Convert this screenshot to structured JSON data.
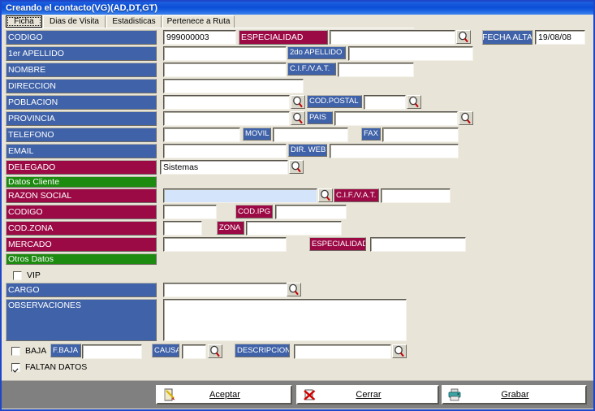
{
  "window": {
    "title": "Creando el contacto(VG)(AD,DT,GT)"
  },
  "tabs": [
    {
      "label": "Ficha",
      "selected": true
    },
    {
      "label": "Dias de Visita",
      "selected": false
    },
    {
      "label": "Estadisticas",
      "selected": false
    },
    {
      "label": "Pertenece a Ruta",
      "selected": false
    }
  ],
  "form": {
    "codigo_label": "CODIGO",
    "codigo_value": "999000003",
    "especialidad_label": "ESPECIALIDAD",
    "especialidad_value": "",
    "fecha_alta_label": "FECHA ALTA",
    "fecha_alta_value": "19/08/08",
    "apellido1_label": "1er APELLIDO",
    "apellido1_value": "",
    "apellido2_label": "2do APELLIDO",
    "apellido2_value": "",
    "nombre_label": "NOMBRE",
    "nombre_value": "",
    "cif_label": "C.I.F./V.A.T.",
    "cif_value": "",
    "direccion_label": "DIRECCION",
    "direccion_value": "",
    "poblacion_label": "POBLACION",
    "poblacion_value": "",
    "codpostal_label": "COD.POSTAL",
    "codpostal_value": "",
    "provincia_label": "PROVINCIA",
    "provincia_value": "",
    "pais_label": "PAIS",
    "pais_value": "",
    "telefono_label": "TELEFONO",
    "telefono_value": "",
    "movil_label": "MOVIL",
    "movil_value": "",
    "fax_label": "FAX",
    "fax_value": "",
    "email_label": "EMAIL",
    "email_value": "",
    "dirweb_label": "DIR. WEB",
    "dirweb_value": "",
    "delegado_label": "DELEGADO",
    "delegado_value": "Sistemas",
    "datos_cliente_header": "Datos Cliente",
    "razon_social_label": "RAZON SOCIAL",
    "razon_social_value": "",
    "cliente_cif_label": "C.I.F./V.A.T.",
    "cliente_cif_value": "",
    "cliente_codigo_label": "CODIGO",
    "cliente_codigo_value": "",
    "codipg_label": "COD.IPG",
    "codipg_value": "",
    "codzona_label": "COD.ZONA",
    "codzona_value": "",
    "zona_label": "ZONA",
    "zona_value": "",
    "mercado_label": "MERCADO",
    "mercado_value": "",
    "especialidad2_label": "ESPECIALIDAD",
    "especialidad2_value": "",
    "otros_datos_header": "Otros Datos",
    "vip_label": "VIP",
    "vip_checked": false,
    "cargo_label": "CARGO",
    "cargo_value": "",
    "observaciones_label": "OBSERVACIONES",
    "observaciones_value": "",
    "baja_label": "BAJA",
    "baja_checked": false,
    "fbaja_label": "F.BAJA",
    "fbaja_value": "",
    "causa_label": "CAUSA",
    "causa_value": "",
    "descripcion_label": "DESCRIPCION",
    "descripcion_value": "",
    "faltan_datos_label": "FALTAN DATOS",
    "faltan_datos_checked": true
  },
  "buttons": {
    "aceptar": "Aceptar",
    "cerrar": "Cerrar",
    "grabar": "Grabar"
  },
  "colors": {
    "title_blue": "#0b4ed6",
    "label_blue": "#3f62a8",
    "label_maroon": "#9c0a46",
    "label_green": "#1d8a10",
    "client_bg": "#e8e5d8",
    "button_bar": "#808080",
    "highlight_field": "#d4e4fa"
  },
  "icons": {
    "lookup": "magnifier-icon",
    "accept": "notebook-pencil-icon",
    "close": "red-x-icon",
    "save": "printer-icon"
  }
}
